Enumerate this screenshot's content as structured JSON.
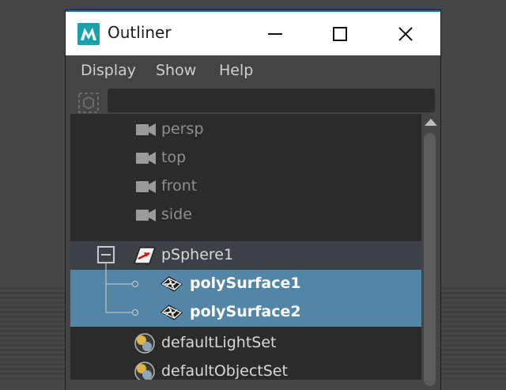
{
  "window": {
    "title": "Outliner"
  },
  "menu": {
    "display": "Display",
    "show": "Show",
    "help": "Help"
  },
  "search": {
    "value": ""
  },
  "tree": {
    "items": [
      {
        "label": "persp",
        "icon": "camera-icon"
      },
      {
        "label": "top",
        "icon": "camera-icon"
      },
      {
        "label": "front",
        "icon": "camera-icon"
      },
      {
        "label": "side",
        "icon": "camera-icon"
      },
      {
        "label": "pSphere1",
        "icon": "transform-icon",
        "expanded": true
      },
      {
        "label": "polySurface1",
        "icon": "mesh-icon",
        "selected": true
      },
      {
        "label": "polySurface2",
        "icon": "mesh-icon",
        "selected": true
      },
      {
        "label": "defaultLightSet",
        "icon": "set-icon"
      },
      {
        "label": "defaultObjectSet",
        "icon": "set-icon"
      }
    ]
  },
  "colors": {
    "selection": "#5285a6",
    "tree_background": "#2b2b2b",
    "titlebar_accent": "#1473d6"
  }
}
